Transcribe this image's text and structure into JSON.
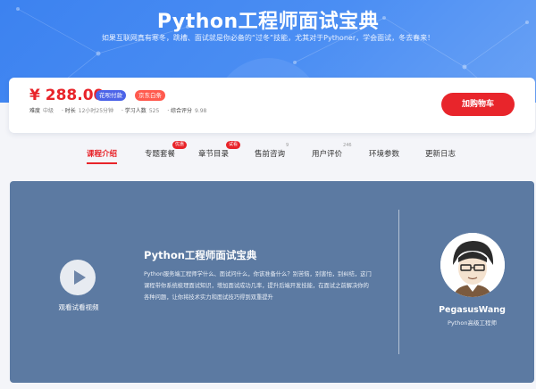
{
  "banner": {
    "title": "Python工程师面试宝典",
    "subtitle": "如果互联网真有寒冬，跳槽、面试就是你必备的“过冬”技能，尤其对于Pythoner，学会面试，冬去春来！"
  },
  "purchase": {
    "price": "¥ 288.00",
    "badges": [
      "花呗付款",
      "京东白条"
    ],
    "meta": [
      {
        "key": "难度",
        "value": "中级"
      },
      {
        "key": "· 时长",
        "value": "12小时25分钟"
      },
      {
        "key": "· 学习人数",
        "value": "525"
      },
      {
        "key": "· 综合评分",
        "value": "9.98"
      }
    ],
    "buy_label": "加购物车"
  },
  "tabs": [
    {
      "label": "课程介绍",
      "active": true
    },
    {
      "label": "专题套餐",
      "pill": "优惠"
    },
    {
      "label": "章节目录",
      "pill": "试看"
    },
    {
      "label": "售前咨询",
      "sup": "9"
    },
    {
      "label": "用户评价",
      "sup": "246"
    },
    {
      "label": "环境参数"
    },
    {
      "label": "更新日志"
    }
  ],
  "video": {
    "play_label": "观看试看视频",
    "title": "Python工程师面试宝典",
    "description": "Python服务端工程师学什么、面试问什么，你该准备什么？别苦恼，别害怕，别纠结，这门课程带你系统梳理面试知识，增加面试成功几率，提升后端开发技能，在面试之前解决你的各种问题，让你将技术实力和面试技巧得到双重提升"
  },
  "teacher": {
    "name": "PegasusWang",
    "title": "Python高级工程师"
  },
  "colors": {
    "banner_blue": "#3c82f0",
    "price_red": "#e8242a",
    "video_bg": "#5c7aa2",
    "badge_blue": "#4c64e8",
    "badge_red": "#ff5a4e"
  }
}
